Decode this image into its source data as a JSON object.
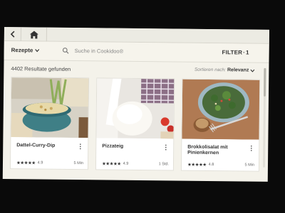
{
  "toolbar": {
    "back_icon": "chevron-left-icon",
    "home_icon": "home-icon"
  },
  "filterbar": {
    "category_label": "Rezepte",
    "search_placeholder": "Suche in Cookidoo®",
    "filter_label": "FILTER",
    "filter_count": "1"
  },
  "results": {
    "count_text": "4402 Resultate gefunden",
    "sort_prefix": "Sortieren nach:",
    "sort_value": "Relevanz"
  },
  "recipes": [
    {
      "title": "Dattel-Curry-Dip",
      "stars": "★★★★★",
      "rating": "4.9",
      "time": "5 Min",
      "rating_value": 4.9
    },
    {
      "title": "Pizzateig",
      "stars": "★★★★★",
      "rating": "4.9",
      "time": "1 Std.",
      "rating_value": 4.9
    },
    {
      "title": "Brokkolisalat mit Pinienkernen",
      "stars": "★★★★★",
      "rating": "4.8",
      "time": "5 Min",
      "rating_value": 4.8
    }
  ],
  "colors": {
    "screen_bg": "#f4f2ea",
    "accent_text": "#333333",
    "muted_text": "#888888"
  }
}
